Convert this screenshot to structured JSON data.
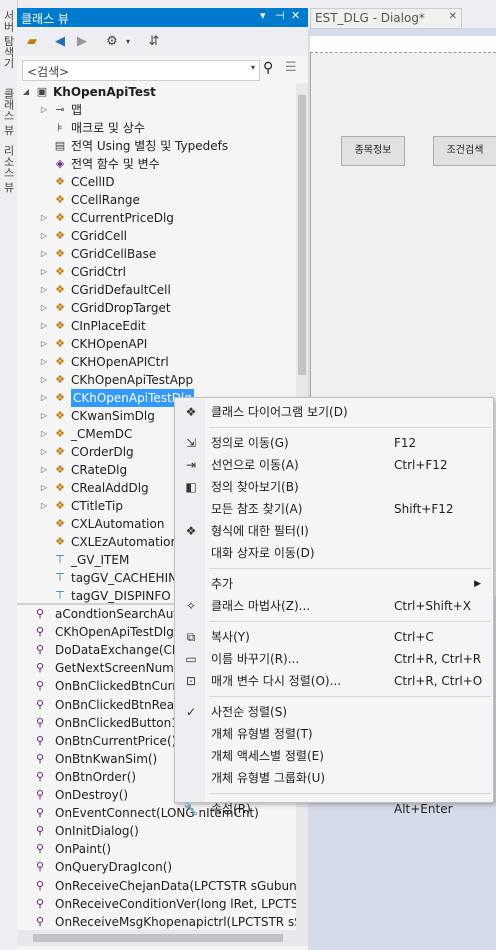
{
  "left_tabs": [
    "서버 탐색기",
    "클래스 뷰",
    "리소스 뷰"
  ],
  "pane": {
    "title": "클래스 뷰",
    "controls": [
      "▾",
      "⊣",
      "✕"
    ],
    "search_placeholder": "<검색>"
  },
  "tree": [
    {
      "label": "KhOpenApiTest",
      "level": 0,
      "expand": "◢",
      "icon": "project-icon",
      "glyph": "▣",
      "color": "#444444",
      "bold": true
    },
    {
      "label": "맵",
      "level": 1,
      "expand": "▷",
      "icon": "map-icon",
      "glyph": "⊸",
      "color": "#444444"
    },
    {
      "label": "매크로 및 상수",
      "level": 1,
      "expand": "",
      "icon": "macro-icon",
      "glyph": "⊧",
      "color": "#444444"
    },
    {
      "label": "전역 Using 별칭 및 Typedefs",
      "level": 1,
      "expand": "",
      "icon": "typedef-icon",
      "glyph": "▤",
      "color": "#444444"
    },
    {
      "label": "전역 함수 및 변수",
      "level": 1,
      "expand": "",
      "icon": "function-icon",
      "glyph": "◈",
      "color": "#68217a"
    },
    {
      "label": "CCellID",
      "level": 1,
      "expand": "",
      "icon": "class-icon",
      "glyph": "❖",
      "color": "#c27d0e"
    },
    {
      "label": "CCellRange",
      "level": 1,
      "expand": "",
      "icon": "class-icon",
      "glyph": "❖",
      "color": "#c27d0e"
    },
    {
      "label": "CCurrentPriceDlg",
      "level": 1,
      "expand": "▷",
      "icon": "class-icon",
      "glyph": "❖",
      "color": "#c27d0e"
    },
    {
      "label": "CGridCell",
      "level": 1,
      "expand": "▷",
      "icon": "class-icon",
      "glyph": "❖",
      "color": "#c27d0e"
    },
    {
      "label": "CGridCellBase",
      "level": 1,
      "expand": "▷",
      "icon": "class-icon",
      "glyph": "❖",
      "color": "#c27d0e"
    },
    {
      "label": "CGridCtrl",
      "level": 1,
      "expand": "▷",
      "icon": "class-icon",
      "glyph": "❖",
      "color": "#c27d0e"
    },
    {
      "label": "CGridDefaultCell",
      "level": 1,
      "expand": "▷",
      "icon": "class-icon",
      "glyph": "❖",
      "color": "#c27d0e"
    },
    {
      "label": "CGridDropTarget",
      "level": 1,
      "expand": "▷",
      "icon": "class-icon",
      "glyph": "❖",
      "color": "#c27d0e"
    },
    {
      "label": "CInPlaceEdit",
      "level": 1,
      "expand": "▷",
      "icon": "class-icon",
      "glyph": "❖",
      "color": "#c27d0e"
    },
    {
      "label": "CKHOpenAPI",
      "level": 1,
      "expand": "▷",
      "icon": "class-icon",
      "glyph": "❖",
      "color": "#c27d0e"
    },
    {
      "label": "CKHOpenAPICtrl",
      "level": 1,
      "expand": "▷",
      "icon": "class-icon",
      "glyph": "❖",
      "color": "#c27d0e"
    },
    {
      "label": "CKhOpenApiTestApp",
      "level": 1,
      "expand": "▷",
      "icon": "class-icon",
      "glyph": "❖",
      "color": "#c27d0e"
    },
    {
      "label": "CKhOpenApiTestDlg",
      "level": 1,
      "expand": "▷",
      "icon": "class-icon",
      "glyph": "❖",
      "color": "#c27d0e",
      "selected": true
    },
    {
      "label": "CKwanSimDlg",
      "level": 1,
      "expand": "▷",
      "icon": "class-icon",
      "glyph": "❖",
      "color": "#c27d0e"
    },
    {
      "label": "_CMemDC",
      "level": 1,
      "expand": "▷",
      "icon": "class-icon",
      "glyph": "❖",
      "color": "#c27d0e"
    },
    {
      "label": "COrderDlg",
      "level": 1,
      "expand": "▷",
      "icon": "class-icon",
      "glyph": "❖",
      "color": "#c27d0e"
    },
    {
      "label": "CRateDlg",
      "level": 1,
      "expand": "▷",
      "icon": "class-icon",
      "glyph": "❖",
      "color": "#c27d0e"
    },
    {
      "label": "CRealAddDlg",
      "level": 1,
      "expand": "▷",
      "icon": "class-icon",
      "glyph": "❖",
      "color": "#c27d0e"
    },
    {
      "label": "CTitleTip",
      "level": 1,
      "expand": "▷",
      "icon": "class-icon",
      "glyph": "❖",
      "color": "#c27d0e"
    },
    {
      "label": "CXLAutomation",
      "level": 1,
      "expand": "",
      "icon": "class-icon",
      "glyph": "❖",
      "color": "#c27d0e"
    },
    {
      "label": "CXLEzAutomation",
      "level": 1,
      "expand": "",
      "icon": "class-icon",
      "glyph": "❖",
      "color": "#c27d0e"
    },
    {
      "label": "_GV_ITEM",
      "level": 1,
      "expand": "",
      "icon": "struct-icon",
      "glyph": "⊤",
      "color": "#1e6fb5"
    },
    {
      "label": "tagGV_CACHEHINT",
      "level": 1,
      "expand": "",
      "icon": "struct-icon",
      "glyph": "⊤",
      "color": "#1e6fb5"
    },
    {
      "label": "tagGV_DISPINFO",
      "level": 1,
      "expand": "",
      "icon": "struct-icon",
      "glyph": "⊤",
      "color": "#1e6fb5"
    }
  ],
  "members": [
    "aCondtionSearchAuto",
    "CKhOpenApiTestDlg(C",
    "DoDataExchange(CDa",
    "GetNextScreenNum(in",
    "OnBnClickedBtnCurren",
    "OnBnClickedBtnReal()",
    "OnBnClickedButton1()",
    "OnBtnCurrentPrice()",
    "OnBtnKwanSim()",
    "OnBtnOrder()",
    "OnDestroy()",
    "OnEventConnect(LONG nItemCnt)",
    "OnInitDialog()",
    "OnPaint()",
    "OnQueryDragIcon()",
    "OnReceiveChejanData(LPCTSTR sGubun, LO",
    "OnReceiveConditionVer(long lRet, LPCTSTR",
    "OnReceiveMsgKhopenapictrl(LPCTSTR sScrN"
  ],
  "designer": {
    "tab_label": "EST_DLG - Dialog*",
    "buttons": [
      "종목정보",
      "조건검색"
    ]
  },
  "context_menu": [
    {
      "label": "클래스 다이어그램 보기(D)",
      "shortcut": "",
      "icon": "class-diagram-icon",
      "glyph": "❖"
    },
    {
      "sep": true
    },
    {
      "label": "정의로 이동(G)",
      "shortcut": "F12",
      "icon": "goto-definition-icon",
      "glyph": "⇲"
    },
    {
      "label": "선언으로 이동(A)",
      "shortcut": "Ctrl+F12",
      "icon": "goto-declaration-icon",
      "glyph": "⇥"
    },
    {
      "label": "정의 찾아보기(B)",
      "shortcut": "",
      "icon": "browse-definition-icon",
      "glyph": "◧"
    },
    {
      "label": "모든 참조 찾기(A)",
      "shortcut": "Shift+F12",
      "icon": "",
      "glyph": ""
    },
    {
      "label": "형식에 대한 필터(I)",
      "shortcut": "",
      "icon": "filter-icon",
      "glyph": "❖"
    },
    {
      "label": "대화 상자로 이동(D)",
      "shortcut": "",
      "icon": "",
      "glyph": ""
    },
    {
      "sep": true
    },
    {
      "label": "추가",
      "shortcut": "",
      "icon": "",
      "glyph": "",
      "submenu": true
    },
    {
      "label": "클래스 마법사(Z)...",
      "shortcut": "Ctrl+Shift+X",
      "icon": "class-wizard-icon",
      "glyph": "✧"
    },
    {
      "sep": true
    },
    {
      "label": "복사(Y)",
      "shortcut": "Ctrl+C",
      "icon": "copy-icon",
      "glyph": "⧉"
    },
    {
      "label": "이름 바꾸기(R)...",
      "shortcut": "Ctrl+R, Ctrl+R",
      "icon": "rename-icon",
      "glyph": "▭"
    },
    {
      "label": "매개 변수 다시 정렬(O)...",
      "shortcut": "Ctrl+R, Ctrl+O",
      "icon": "reorder-icon",
      "glyph": "⊡"
    },
    {
      "sep": true
    },
    {
      "label": "사전순 정렬(S)",
      "shortcut": "",
      "icon": "check-icon",
      "glyph": "✓"
    },
    {
      "label": "개체 유형별 정렬(T)",
      "shortcut": "",
      "icon": "",
      "glyph": ""
    },
    {
      "label": "개체 액세스별 정렬(E)",
      "shortcut": "",
      "icon": "",
      "glyph": ""
    },
    {
      "label": "개체 유형별 그룹화(U)",
      "shortcut": "",
      "icon": "",
      "glyph": ""
    },
    {
      "sep": true
    },
    {
      "label": "속성(R)",
      "shortcut": "Alt+Enter",
      "icon": "wrench-icon",
      "glyph": "🔧"
    }
  ],
  "colors": {
    "accent": "#007acc",
    "selection": "#3399ff",
    "class_icon": "#c27d0e",
    "method_icon": "#68217a"
  }
}
